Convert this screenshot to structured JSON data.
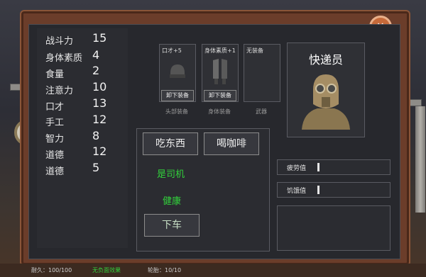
{
  "stats": [
    {
      "label": "战斗力",
      "value": "15"
    },
    {
      "label": "身体素质",
      "value": "4"
    },
    {
      "label": "食量",
      "value": "2"
    },
    {
      "label": "注意力",
      "value": "10"
    },
    {
      "label": "口才",
      "value": "13"
    },
    {
      "label": "手工",
      "value": "12"
    },
    {
      "label": "智力",
      "value": "8"
    },
    {
      "label": "道德",
      "value": "12"
    },
    {
      "label": "道德",
      "value": "5"
    }
  ],
  "equipment": {
    "head": {
      "item_label": "口才+5",
      "button": "卸下装备",
      "caption": "头部装备"
    },
    "body": {
      "item_label": "身体素质+1",
      "button": "卸下装备",
      "caption": "身体装备"
    },
    "weapon": {
      "item_label": "无装备",
      "caption": "武器"
    }
  },
  "character": {
    "title": "快递员"
  },
  "actions": {
    "eat": "吃东西",
    "coffee": "喝咖啡",
    "is_driver": "是司机",
    "health": "健康",
    "get_off": "下车"
  },
  "bars": {
    "fatigue": {
      "label": "疲劳值",
      "fill": 0.02
    },
    "hunger": {
      "label": "饥饿值",
      "fill": 0.02
    }
  },
  "bottom": {
    "left": "耐久：100/100",
    "effect": "无负面效果",
    "wheel": "轮胎：10/10"
  },
  "colors": {
    "accent_green": "#32d23c",
    "frame": "#6b3d2a"
  }
}
